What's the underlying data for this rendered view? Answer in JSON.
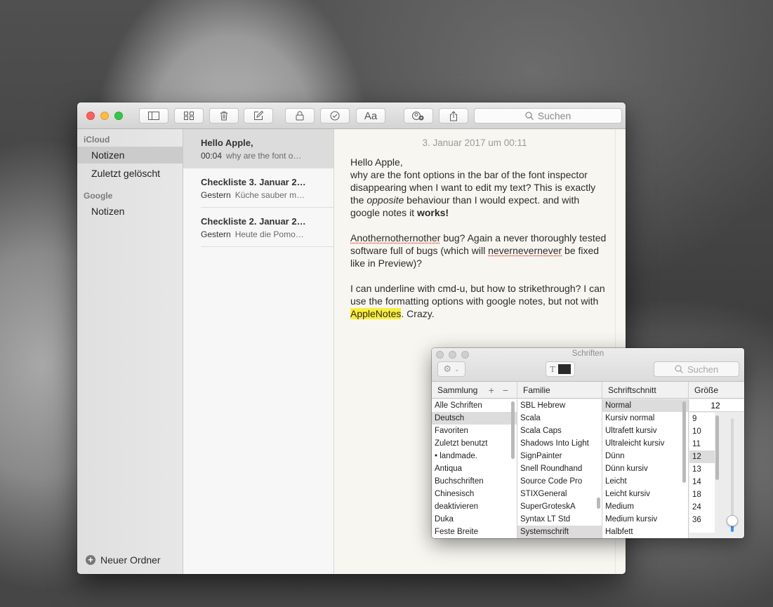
{
  "toolbar": {
    "search_placeholder": "Suchen",
    "buttons": [
      "sidebar-toggle",
      "gallery-view",
      "delete",
      "new-note",
      "lock",
      "checklist",
      "font-format",
      "share-collaborate",
      "share"
    ],
    "format_label": "Aa"
  },
  "sidebar": {
    "sections": [
      {
        "title": "iCloud",
        "items": [
          {
            "label": "Notizen",
            "selected": true
          },
          {
            "label": "Zuletzt gelöscht",
            "selected": false
          }
        ]
      },
      {
        "title": "Google",
        "items": [
          {
            "label": "Notizen",
            "selected": false
          }
        ]
      }
    ],
    "new_folder_label": "Neuer Ordner"
  },
  "note_list": [
    {
      "title": "Hello Apple,",
      "date": "00:04",
      "preview": "why are the font o…",
      "selected": true
    },
    {
      "title": "Checkliste 3. Januar 2…",
      "date": "Gestern",
      "preview": "Küche sauber m…",
      "selected": false
    },
    {
      "title": "Checkliste 2. Januar 2…",
      "date": "Gestern",
      "preview": "Heute die Pomo…",
      "selected": false
    }
  ],
  "editor": {
    "date": "3. Januar 2017 um 00:11",
    "p1_line1": "Hello Apple,",
    "p1_a": "why are the font options in the bar of the font inspector disappearing when I want to edit my text? This is exactly the ",
    "p1_italic": "opposite",
    "p1_b": " behaviour than I would expect. and with google notes it ",
    "p1_bold": "works!",
    "p2_misspelled1": "Anothernothernother",
    "p2_a": " bug? Again a never thoroughly tested software full of bugs (which will ",
    "p2_misspelled2": "nevernevernever",
    "p2_b": " be fixed like in Preview)?",
    "p3_a": "I can underline with cmd-u, but how to strikethrough? I can use the formatting options with google notes, but not with ",
    "p3_highlight": "AppleNotes",
    "p3_b": ". Crazy."
  },
  "fonts_panel": {
    "title": "Schriften",
    "search_placeholder": "Suchen",
    "color_glyph": "T",
    "headers": {
      "collection": "Sammlung",
      "family": "Familie",
      "typeface": "Schriftschnitt",
      "size": "Größe"
    },
    "plus_minus": "+ −",
    "collections": [
      "Alle Schriften",
      "Deutsch",
      "Favoriten",
      "Zuletzt benutzt",
      "• landmade.",
      "Antiqua",
      "Buchschriften",
      "Chinesisch",
      "deaktivieren",
      "Duka",
      "Feste Breite"
    ],
    "collection_selected": "Deutsch",
    "families": [
      "SBL Hebrew",
      "Scala",
      "Scala Caps",
      "Shadows Into Light",
      "SignPainter",
      "Snell Roundhand",
      "Source Code Pro",
      "STIXGeneral",
      "SuperGroteskA",
      "Syntax LT Std",
      "Systemschrift"
    ],
    "family_selected": "Systemschrift",
    "typefaces": [
      "Normal",
      "Kursiv normal",
      "Ultrafett kursiv",
      "Ultraleicht kursiv",
      "Dünn",
      "Dünn kursiv",
      "Leicht",
      "Leicht kursiv",
      "Medium",
      "Medium kursiv",
      "Halbfett"
    ],
    "typeface_selected": "Normal",
    "size_value": "12",
    "sizes": [
      "9",
      "10",
      "11",
      "12",
      "13",
      "14",
      "18",
      "24",
      "36"
    ],
    "size_selected": "12",
    "size_slider_fraction": 0.12
  }
}
